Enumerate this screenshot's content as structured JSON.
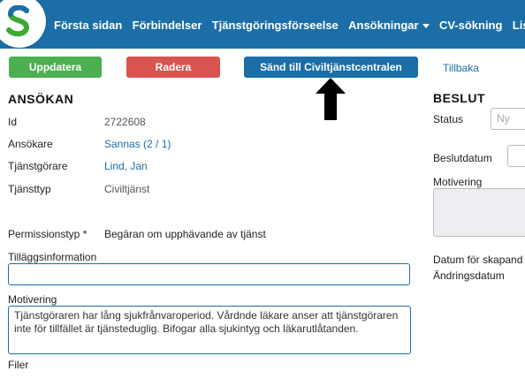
{
  "nav": {
    "items": [
      {
        "label": "Första sidan"
      },
      {
        "label": "Förbindelser"
      },
      {
        "label": "Tjänstgöringsförseelse"
      },
      {
        "label": "Ansökningar",
        "dropdown": true
      },
      {
        "label": "CV-sökning"
      },
      {
        "label": "Listm"
      }
    ],
    "brand_color": "#1b6ea8"
  },
  "toolbar": {
    "update_label": "Uppdatera",
    "delete_label": "Radera",
    "send_label": "Sänd till Civiltjänstcentralen",
    "back_label": "Tillbaka"
  },
  "application": {
    "heading": "ANSÖKAN",
    "id_label": "Id",
    "id_value": "2722608",
    "applicant_label": "Ansökare",
    "applicant_value": "Sannas (2 / 1)",
    "servant_label": "Tjänstgörare",
    "servant_value": "Lind, Jan",
    "service_type_label": "Tjänsttyp",
    "service_type_value": "Civiltjänst",
    "permission_type_label": "Permissionstyp *",
    "permission_type_value": "Begäran om upphävande av tjänst",
    "additional_info_label": "Tilläggsinformation",
    "additional_info_value": "",
    "motivation_label": "Motivering",
    "motivation_value": "Tjänstgöraren har lång sjukfrånvaroperiod. Vårdnde läkare anser att tjänstgöraren inte för tillfället är tjänsteduglig. Bifogar alla sjukintyg och läkarutlåtanden.",
    "files_label": "Filer"
  },
  "decision": {
    "heading": "BESLUT",
    "status_label": "Status",
    "status_value": "Ny",
    "decision_date_label": "Beslutdatum",
    "motivation_label": "Motivering",
    "created_date_label": "Datum för skapand",
    "modified_date_label": "Ändringsdatum"
  },
  "icons": {
    "logo": "logo-s-icon",
    "arrow": "arrow-up-icon",
    "dropdown": "caret-down-icon"
  }
}
